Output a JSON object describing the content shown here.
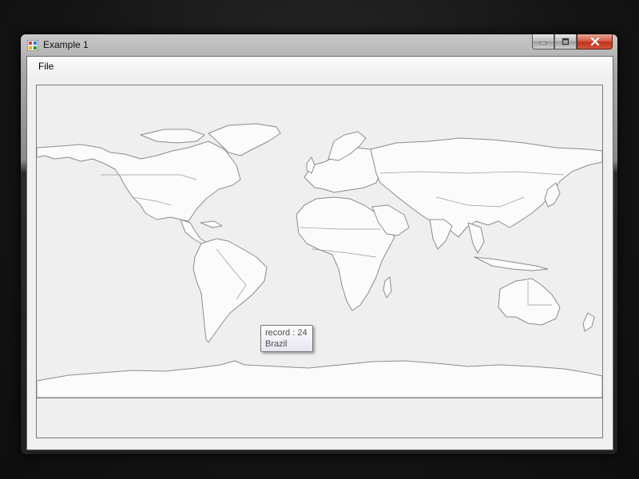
{
  "window": {
    "title": "Example 1",
    "icon": "app-icon",
    "caption_buttons": [
      "minimize-icon",
      "maximize-icon",
      "close-icon"
    ]
  },
  "menu": {
    "items": [
      {
        "label": "File"
      }
    ]
  },
  "map": {
    "description_icon": "world-map",
    "land_fill": "#fbfbfb",
    "border_color": "#8c8c8c",
    "background": "#efefef"
  },
  "tooltip": {
    "line1": "record : 24",
    "line2": "Brazil"
  }
}
